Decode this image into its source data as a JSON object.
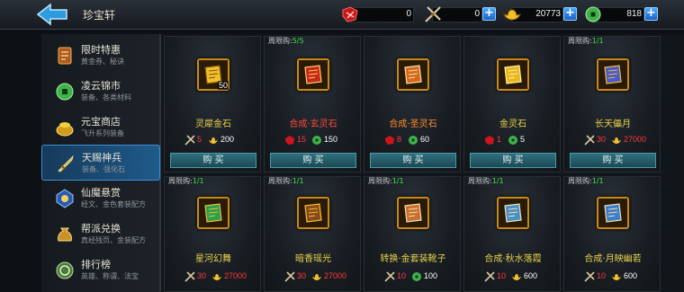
{
  "header": {
    "title": "珍宝轩",
    "back_icon": "back-arrow-icon",
    "resources": [
      {
        "icon": "red-token-icon",
        "value": "0",
        "has_plus": false
      },
      {
        "icon": "crossed-swords-icon",
        "value": "0",
        "has_plus": true
      },
      {
        "icon": "gold-ingot-icon",
        "value": "20773",
        "has_plus": true
      },
      {
        "icon": "jade-coin-icon",
        "value": "818",
        "has_plus": true
      }
    ]
  },
  "sidebar": {
    "items": [
      {
        "name": "限时特惠",
        "sub": "黄金券、秘诀",
        "icon": "scroll-icon",
        "active": false
      },
      {
        "name": "凌云锦市",
        "sub": "装备、各类材料",
        "icon": "jade-coin-icon",
        "active": false
      },
      {
        "name": "元宝商店",
        "sub": "飞升系列装备",
        "icon": "gold-pot-icon",
        "active": false
      },
      {
        "name": "天赐神兵",
        "sub": "装备、强化石",
        "icon": "weapon-icon",
        "active": true
      },
      {
        "name": "仙魔悬赏",
        "sub": "经文、金色套装配方",
        "icon": "bounty-icon",
        "active": false
      },
      {
        "name": "帮派兑换",
        "sub": "真经残页、金装配方",
        "icon": "coin-bag-icon",
        "active": false
      },
      {
        "name": "排行榜",
        "sub": "英雄、称谓、法宝",
        "icon": "ranking-icon",
        "active": false
      }
    ]
  },
  "shop": {
    "buy_label": "购 买",
    "limit_prefix": "周限购:",
    "rows": [
      [
        {
          "limit": "",
          "name": "灵犀金石",
          "name_color": "#e8d24a",
          "icon": "gold-stone-icon",
          "qty": "50",
          "price1": "5",
          "price2": "200",
          "c1": "sword-icon",
          "c2": "ingot-icon"
        },
        {
          "limit": "5/5",
          "name": "合成·玄灵石",
          "name_color": "#ff4a3c",
          "icon": "red-scroll-icon",
          "qty": "",
          "price1": "15",
          "price2": "150",
          "c1": "red-token-icon",
          "c2": "jade-coin-icon"
        },
        {
          "limit": "",
          "name": "合成·圣灵石",
          "name_color": "#ff8a2a",
          "icon": "orange-scroll-icon",
          "qty": "",
          "price1": "8",
          "price2": "60",
          "c1": "red-token-icon",
          "c2": "jade-coin-icon"
        },
        {
          "limit": "",
          "name": "金灵石",
          "name_color": "#e8d24a",
          "icon": "gold-cube-icon",
          "qty": "",
          "price1": "1",
          "price2": "5",
          "c1": "red-token-icon",
          "c2": "jade-coin-icon"
        },
        {
          "limit": "1/1",
          "name": "长天儡月",
          "name_color": "#e8d24a",
          "icon": "boots-icon",
          "qty": "",
          "price1": "30",
          "price2": "27000",
          "c1": "sword-icon",
          "c2": "ingot-icon"
        }
      ],
      [
        {
          "limit": "1/1",
          "name": "星河幻舞",
          "name_color": "#e8d24a",
          "icon": "green-boots-icon",
          "qty": "",
          "price1": "30",
          "price2": "27000",
          "c1": "sword-icon",
          "c2": "ingot-icon"
        },
        {
          "limit": "1/1",
          "name": "暗香瑶光",
          "name_color": "#e8d24a",
          "icon": "brown-boots-icon",
          "qty": "",
          "price1": "30",
          "price2": "27000",
          "c1": "sword-icon",
          "c2": "ingot-icon"
        },
        {
          "limit": "1/1",
          "name": "转换·金套装靴子",
          "name_color": "#e8d24a",
          "icon": "recipe-scroll-icon",
          "qty": "",
          "price1": "10",
          "price2": "100",
          "c1": "sword-icon",
          "c2": "jade-coin-icon"
        },
        {
          "limit": "1/1",
          "name": "合成·秋水落霞",
          "name_color": "#e8d24a",
          "icon": "autumn-scroll-icon",
          "qty": "",
          "price1": "10",
          "price2": "600",
          "c1": "sword-icon",
          "c2": "ingot-icon"
        },
        {
          "limit": "1/1",
          "name": "合成·月映幽若",
          "name_color": "#e8d24a",
          "icon": "moon-scroll-icon",
          "qty": "",
          "price1": "10",
          "price2": "600",
          "c1": "sword-icon",
          "c2": "ingot-icon"
        }
      ]
    ]
  },
  "colors": {
    "price_red": "#ff3a3a",
    "price_white": "#ffffff",
    "limit_green": "#3ee04a"
  }
}
